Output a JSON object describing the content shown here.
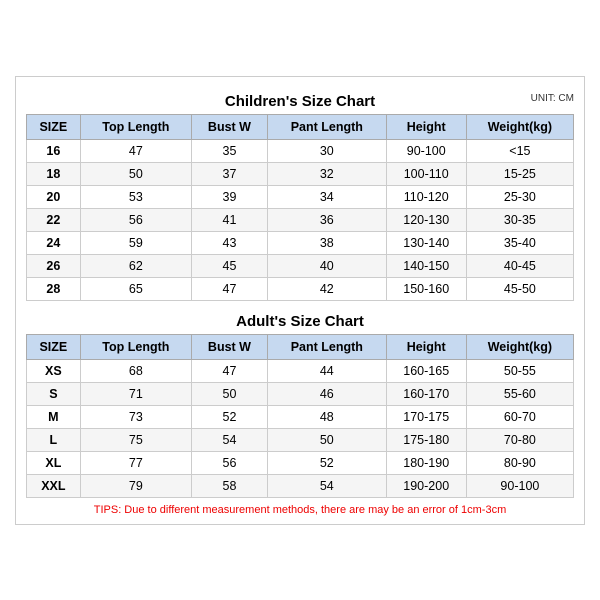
{
  "children_title": "Children's Size Chart",
  "adult_title": "Adult's Size Chart",
  "unit": "UNIT: CM",
  "columns": [
    "SIZE",
    "Top Length",
    "Bust W",
    "Pant Length",
    "Height",
    "Weight(kg)"
  ],
  "children_rows": [
    [
      "16",
      "47",
      "35",
      "30",
      "90-100",
      "<15"
    ],
    [
      "18",
      "50",
      "37",
      "32",
      "100-110",
      "15-25"
    ],
    [
      "20",
      "53",
      "39",
      "34",
      "110-120",
      "25-30"
    ],
    [
      "22",
      "56",
      "41",
      "36",
      "120-130",
      "30-35"
    ],
    [
      "24",
      "59",
      "43",
      "38",
      "130-140",
      "35-40"
    ],
    [
      "26",
      "62",
      "45",
      "40",
      "140-150",
      "40-45"
    ],
    [
      "28",
      "65",
      "47",
      "42",
      "150-160",
      "45-50"
    ]
  ],
  "adult_rows": [
    [
      "XS",
      "68",
      "47",
      "44",
      "160-165",
      "50-55"
    ],
    [
      "S",
      "71",
      "50",
      "46",
      "160-170",
      "55-60"
    ],
    [
      "M",
      "73",
      "52",
      "48",
      "170-175",
      "60-70"
    ],
    [
      "L",
      "75",
      "54",
      "50",
      "175-180",
      "70-80"
    ],
    [
      "XL",
      "77",
      "56",
      "52",
      "180-190",
      "80-90"
    ],
    [
      "XXL",
      "79",
      "58",
      "54",
      "190-200",
      "90-100"
    ]
  ],
  "tips": "TIPS: Due to different measurement methods, there are may be an error of 1cm-3cm"
}
